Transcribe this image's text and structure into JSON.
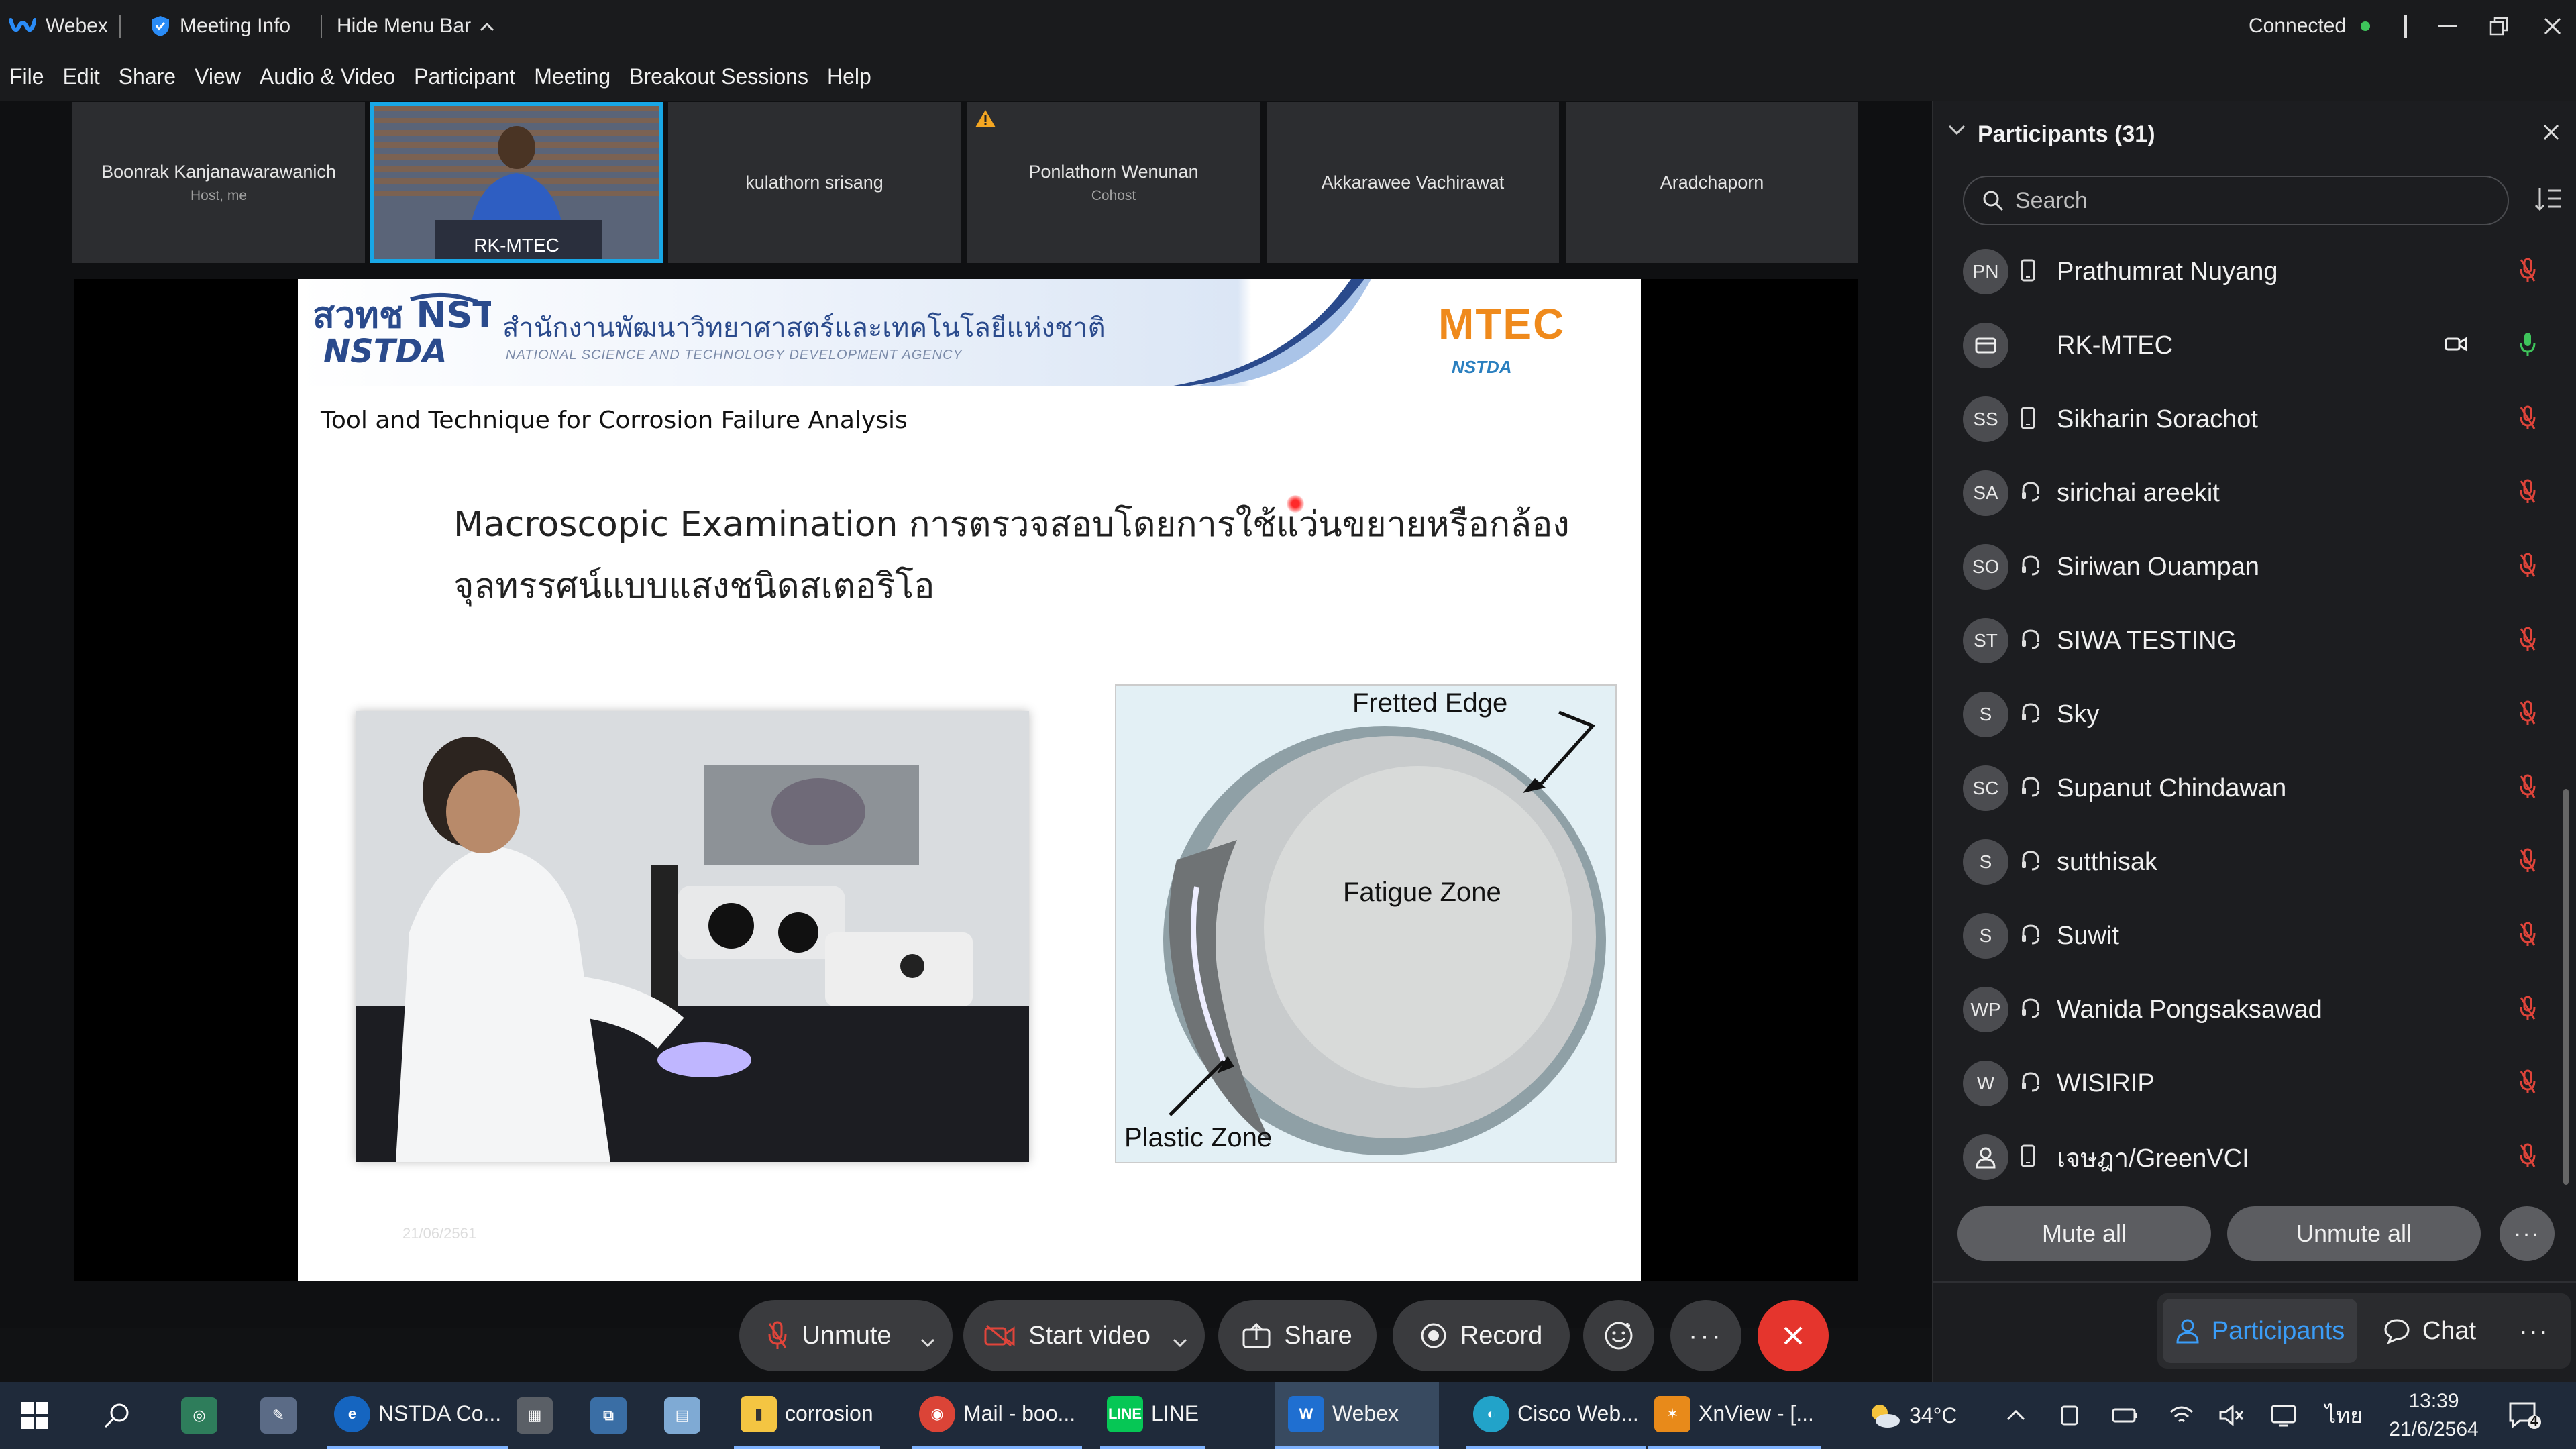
{
  "window": {
    "app_title": "Webex",
    "meeting_info": "Meeting Info",
    "hide_menu_bar": "Hide Menu Bar",
    "status": "Connected"
  },
  "menu": [
    "File",
    "Edit",
    "Share",
    "View",
    "Audio & Video",
    "Participant",
    "Meeting",
    "Breakout Sessions",
    "Help"
  ],
  "video_strip": [
    {
      "name": "Boonrak Kanjanawarawanich",
      "role": "Host, me"
    },
    {
      "name": "RK-MTEC",
      "role": ""
    },
    {
      "name": "kulathorn srisang",
      "role": ""
    },
    {
      "name": "Ponlathorn Wenunan",
      "role": "Cohost"
    },
    {
      "name": "Akkarawee Vachirawat",
      "role": ""
    },
    {
      "name": "Aradchaporn",
      "role": ""
    }
  ],
  "slide": {
    "org_thai": "สำนักงานพัฒนาวิทยาศาสตร์และเทคโนโลยีแห่งชาติ",
    "org_english": "NATIONAL SCIENCE AND TECHNOLOGY DEVELOPMENT AGENCY",
    "logo_left": "สวทช NSTDA",
    "logo_right": "MTEC",
    "logo_right_sub": "NSTDA",
    "subtitle": "Tool and Technique for Corrosion Failure Analysis",
    "heading_line1": "Macroscopic Examination การตรวจสอบโดยการใช้แว่นขยายหรือกล้อง",
    "heading_line2": "จุลทรรศน์แบบแสงชนิดสเตอริโอ",
    "image2_labels": {
      "fretted_edge": "Fretted Edge",
      "fatigue_zone": "Fatigue Zone",
      "plastic_zone": "Plastic Zone"
    },
    "footer_date": "21/06/2561"
  },
  "controls": {
    "unmute": "Unmute",
    "start_video": "Start video",
    "share": "Share",
    "record": "Record",
    "more": "···"
  },
  "participants_panel": {
    "title": "Participants (31)",
    "search_placeholder": "Search",
    "participants": [
      {
        "initials": "PN",
        "name": "Prathumrat Nuyang",
        "device": "phone",
        "muted": true
      },
      {
        "initials": "",
        "name": "RK-MTEC",
        "device": "room",
        "muted": false
      },
      {
        "initials": "SS",
        "name": "Sikharin Sorachot",
        "device": "phone",
        "muted": true
      },
      {
        "initials": "SA",
        "name": "sirichai areekit",
        "device": "headset",
        "muted": true
      },
      {
        "initials": "SO",
        "name": "Siriwan Ouampan",
        "device": "headset",
        "muted": true
      },
      {
        "initials": "ST",
        "name": "SIWA TESTING",
        "device": "headset",
        "muted": true
      },
      {
        "initials": "S",
        "name": "Sky",
        "device": "headset",
        "muted": true
      },
      {
        "initials": "SC",
        "name": "Supanut Chindawan",
        "device": "headset",
        "muted": true
      },
      {
        "initials": "S",
        "name": "sutthisak",
        "device": "headset",
        "muted": true
      },
      {
        "initials": "S",
        "name": "Suwit",
        "device": "headset",
        "muted": true
      },
      {
        "initials": "WP",
        "name": "Wanida Pongsaksawad",
        "device": "headset",
        "muted": true
      },
      {
        "initials": "W",
        "name": "WISIRIP",
        "device": "headset",
        "muted": true
      },
      {
        "initials": "",
        "name": "เจษฎา/GreenVCI",
        "device": "phone",
        "muted": true
      }
    ],
    "mute_all": "Mute all",
    "unmute_all": "Unmute all",
    "more": "···"
  },
  "tabs": {
    "participants": "Participants",
    "chat": "Chat",
    "more": "···"
  },
  "taskbar": {
    "apps": [
      {
        "label": "NSTDA Co...",
        "icon_color": "#1565c0"
      },
      {
        "label": "corrosion",
        "icon_color": "#f4c542"
      },
      {
        "label": "Mail - boo...",
        "icon_color": "#db4437"
      },
      {
        "label": "LINE",
        "icon_color": "#06c755"
      },
      {
        "label": "Webex",
        "icon_color": "#1f6fd1"
      },
      {
        "label": "Cisco Web...",
        "icon_color": "#22a3c9"
      },
      {
        "label": "XnView - [...",
        "icon_color": "#e88a1a"
      }
    ],
    "weather": "34°C",
    "language": "ไทย",
    "time": "13:39",
    "date": "21/6/2564",
    "notification_count": "4"
  },
  "colors": {
    "accent_blue": "#18a7e6",
    "leave_red": "#e5352d",
    "muted_red": "#e0443a",
    "connected_green": "#3ec45b"
  }
}
